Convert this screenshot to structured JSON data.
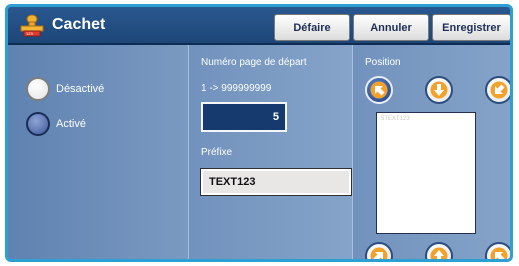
{
  "header": {
    "title": "Cachet",
    "buttons": {
      "undo": "Défaire",
      "cancel": "Annuler",
      "save": "Enregistrer"
    },
    "icon": "stamp-icon"
  },
  "left": {
    "options": [
      {
        "label": "Désactivé",
        "selected": false
      },
      {
        "label": "Activé",
        "selected": true
      }
    ]
  },
  "middle": {
    "start_page_label": "Numéro page de départ",
    "range": "1 -> 999999999",
    "start_page_value": "5",
    "prefix_label": "Préfixe",
    "prefix_value": "TEXT123"
  },
  "right": {
    "position_label": "Position",
    "preview_text": "5TEXT123",
    "selected_position": "top-left",
    "buttons": [
      {
        "name": "top-left",
        "icon": "arrow-up-left-icon"
      },
      {
        "name": "top-center",
        "icon": "arrow-up-icon"
      },
      {
        "name": "top-right",
        "icon": "arrow-up-right-icon"
      },
      {
        "name": "bottom-left",
        "icon": "arrow-down-left-icon"
      },
      {
        "name": "bottom-center",
        "icon": "arrow-down-icon"
      },
      {
        "name": "bottom-right",
        "icon": "arrow-down-right-icon"
      }
    ]
  },
  "colors": {
    "frame": "#2c9fd3",
    "header": "#1d4678",
    "arrow_orange": "#f2a12a"
  }
}
